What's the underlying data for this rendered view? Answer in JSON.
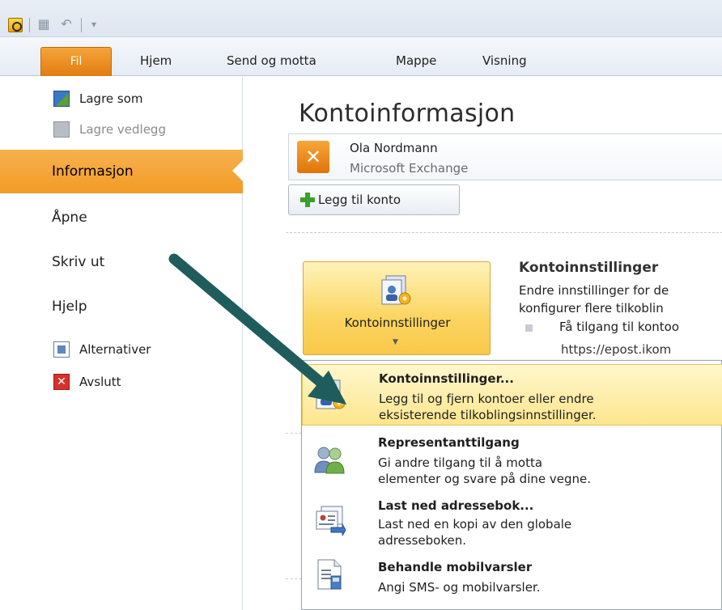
{
  "tabs": {
    "file": "Fil",
    "home": "Hjem",
    "send_receive": "Send og motta",
    "folder": "Mappe",
    "view": "Visning"
  },
  "nav": {
    "save_as": "Lagre som",
    "save_attachments": "Lagre vedlegg",
    "info": "Informasjon",
    "open": "Åpne",
    "print": "Skriv ut",
    "help": "Hjelp",
    "options": "Alternativer",
    "exit": "Avslutt"
  },
  "main": {
    "title": "Kontoinformasjon",
    "account_name": "Ola Nordmann",
    "account_type": "Microsoft Exchange",
    "add_account": "Legg til konto",
    "settings_button": "Kontoinnstillinger",
    "settings_title": "Kontoinnstillinger",
    "settings_desc_1": "Endre innstillinger for de",
    "settings_desc_2": "konfigurer flere tilkoblin",
    "access_label": "Få tilgang til kontoo",
    "url": "https://epost.ikom"
  },
  "menu": {
    "item1_title": "Kontoinnstillinger...",
    "item1_desc_1": "Legg til og fjern kontoer eller endre",
    "item1_desc_2": "eksisterende tilkoblingsinnstillinger.",
    "item2_title": "Representanttilgang",
    "item2_desc_1": "Gi andre tilgang til å motta",
    "item2_desc_2": "elementer og svare på dine vegne.",
    "item3_title": "Last ned adressebok...",
    "item3_desc_1": "Last ned en kopi av den globale",
    "item3_desc_2": "adresseboken.",
    "item4_title": "Behandle mobilvarsler",
    "item4_desc_1": "Angi SMS- og mobilvarsler."
  },
  "colors": {
    "accent_orange": "#f29b25",
    "highlight_yellow": "#fde68e",
    "arrow": "#1f5d5d"
  }
}
